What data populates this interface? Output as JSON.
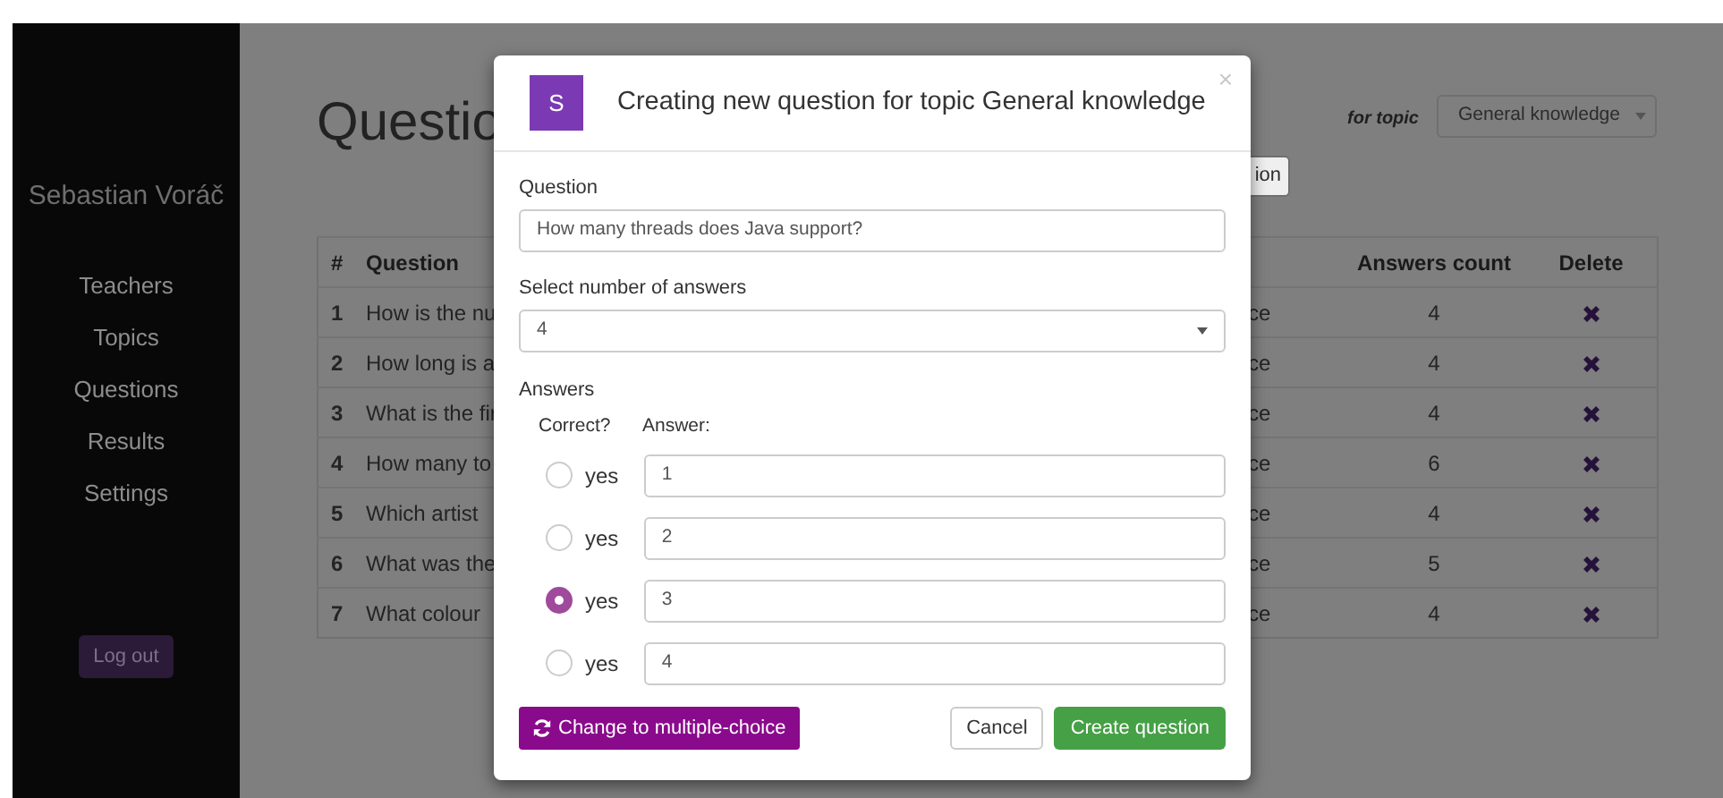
{
  "sidebar": {
    "user_name": "Sebastian Voráč",
    "items": [
      {
        "label": "Teachers"
      },
      {
        "label": "Topics"
      },
      {
        "label": "Questions"
      },
      {
        "label": "Results"
      },
      {
        "label": "Settings"
      }
    ],
    "logout_button": "Log out"
  },
  "page": {
    "title": "Questio",
    "topic_label": "for topic",
    "topic_select": "General knowledge",
    "add_button": "ion"
  },
  "table": {
    "columns": [
      "#",
      "Question",
      "Answers count",
      "Delete"
    ],
    "rows": [
      {
        "number": "1",
        "question": "How is the nu",
        "column_3": "ce",
        "answers_count": "4"
      },
      {
        "number": "2",
        "question": "How long is a",
        "column_3": "ce",
        "answers_count": "4"
      },
      {
        "number": "3",
        "question": "What is the fir",
        "column_3": "ce",
        "answers_count": "4"
      },
      {
        "number": "4",
        "question": "How many to",
        "column_3": "ce",
        "answers_count": "6"
      },
      {
        "number": "5",
        "question": "Which artist",
        "column_3": "ce",
        "answers_count": "4"
      },
      {
        "number": "6",
        "question": "What was the",
        "column_3": "ce",
        "answers_count": "5"
      },
      {
        "number": "7",
        "question": "What colour",
        "column_3": "ce",
        "answers_count": "4"
      }
    ]
  },
  "dialog": {
    "logo_letter": "S",
    "title": "Creating new question for topic General knowledge",
    "close": "×",
    "question_label": "Question",
    "question_value": "How many threads does Java support?",
    "count_label": "Select number of answers",
    "count_value": "4",
    "answers_label": "Answers",
    "correct_header": "Correct?",
    "answer_header": "Answer:",
    "answers": [
      {
        "option_label": "yes",
        "selected": false,
        "value": "1"
      },
      {
        "option_label": "yes",
        "selected": false,
        "value": "2"
      },
      {
        "option_label": "yes",
        "selected": true,
        "value": "3"
      },
      {
        "option_label": "yes",
        "selected": false,
        "value": "4"
      }
    ],
    "switch_button": "Change to multiple-choice",
    "cancel_button": "Cancel",
    "create_button": "Create question"
  }
}
